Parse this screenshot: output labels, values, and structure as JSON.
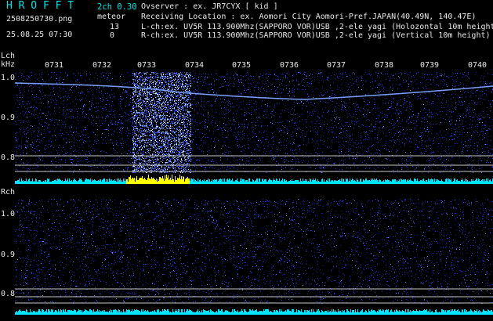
{
  "header": {
    "logo": "H R O F F T",
    "filename": "2508250730.png",
    "datetime": "25.08.25 07:30",
    "mode": "2ch 0.30",
    "meteor_label": "meteor",
    "meteor_left": "13",
    "meteor_right": "0",
    "observer": "Ovserver            : ex. JR7CYX [ kid ]",
    "location": "Receiving Location : ex. Aomori City Aomori-Pref.JAPAN(40.49N, 140.47E)",
    "lch": "L-ch:ex. UV5R 113.900Mhz(SAPPORO VOR)USB ,2-ele yagi (Holozontal 10m height)",
    "rch": "R-ch:ex. UV5R 113.900Mhz(SAPPORO VOR)USB ,2-ele yagi (Vertical 10m height)"
  },
  "left_panel": {
    "channel": "Lch",
    "unit": "kHz",
    "y_labels": [
      "1.0",
      "0.9",
      "0.8"
    ]
  },
  "right_panel": {
    "channel": "Rch",
    "y_labels": [
      "1.0",
      "0.9",
      "0.8"
    ]
  },
  "time_ticks": [
    "0731",
    "0732",
    "0733",
    "0734",
    "0735",
    "0736",
    "0737",
    "0738",
    "0739",
    "0740"
  ],
  "colors": {
    "background": "#000000",
    "noise": "#2a3cff",
    "baseline": "#00e5ff",
    "meteor": "#ffff00",
    "text_cyan": "#00e5e5",
    "text_white": "#e8e8e8"
  }
}
